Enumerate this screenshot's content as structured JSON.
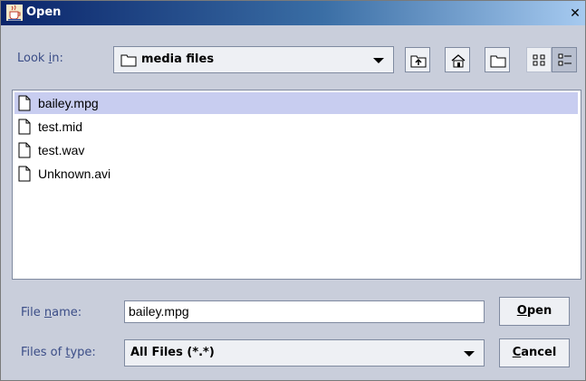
{
  "window": {
    "title": "Open"
  },
  "look_in": {
    "label_pre": "Look ",
    "label_mnemonic": "i",
    "label_post": "n:",
    "value": "media files"
  },
  "files": [
    {
      "name": "bailey.mpg",
      "selected": true
    },
    {
      "name": "test.mid",
      "selected": false
    },
    {
      "name": "test.wav",
      "selected": false
    },
    {
      "name": "Unknown.avi",
      "selected": false
    }
  ],
  "file_name": {
    "label_pre": "File ",
    "label_mnemonic": "n",
    "label_post": "ame:",
    "value": "bailey.mpg"
  },
  "file_type": {
    "label_pre": "Files of ",
    "label_mnemonic": "t",
    "label_post": "ype:",
    "value": "All Files (*.*)"
  },
  "buttons": {
    "open_mnemonic": "O",
    "open_rest": "pen",
    "cancel_mnemonic": "C",
    "cancel_rest": "ancel"
  },
  "icons": {
    "title": "java-cup-icon",
    "close": "close-icon",
    "up": "up-folder-icon",
    "home": "home-icon",
    "new_folder": "new-folder-icon",
    "list_view": "list-view-icon",
    "details_view": "details-view-icon",
    "file": "file-icon",
    "folder": "folder-icon"
  },
  "colors": {
    "selection": "#c8cdf0",
    "label": "#3b4d87",
    "title_bar": "#0a246a"
  }
}
